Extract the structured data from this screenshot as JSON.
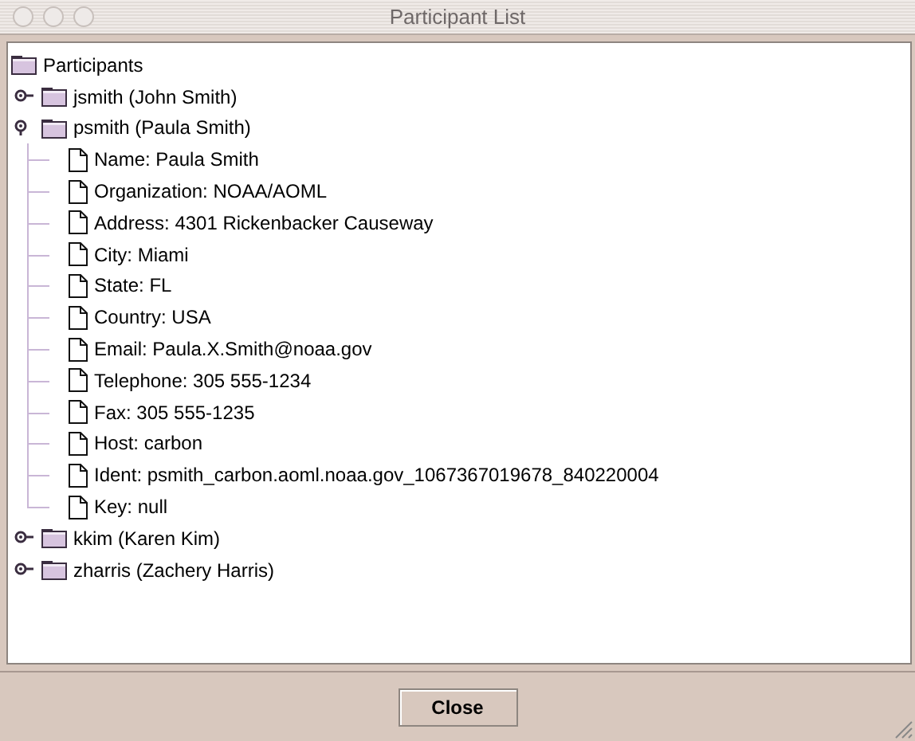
{
  "window": {
    "title": "Participant List"
  },
  "tree": {
    "label": "Participants",
    "children": [
      {
        "label": "jsmith (John Smith)",
        "expanded": false
      },
      {
        "label": "psmith (Paula Smith)",
        "expanded": true,
        "children": [
          {
            "label": "Name: Paula Smith"
          },
          {
            "label": "Organization: NOAA/AOML"
          },
          {
            "label": "Address: 4301 Rickenbacker Causeway"
          },
          {
            "label": "City: Miami"
          },
          {
            "label": "State: FL"
          },
          {
            "label": "Country: USA"
          },
          {
            "label": "Email: Paula.X.Smith@noaa.gov"
          },
          {
            "label": "Telephone: 305 555-1234"
          },
          {
            "label": "Fax: 305 555-1235"
          },
          {
            "label": "Host: carbon"
          },
          {
            "label": "Ident: psmith_carbon.aoml.noaa.gov_1067367019678_840220004"
          },
          {
            "label": "Key: null"
          }
        ]
      },
      {
        "label": "kkim (Karen Kim)",
        "expanded": false
      },
      {
        "label": "zharris (Zachery Harris)",
        "expanded": false
      }
    ]
  },
  "buttons": [
    "Close"
  ]
}
